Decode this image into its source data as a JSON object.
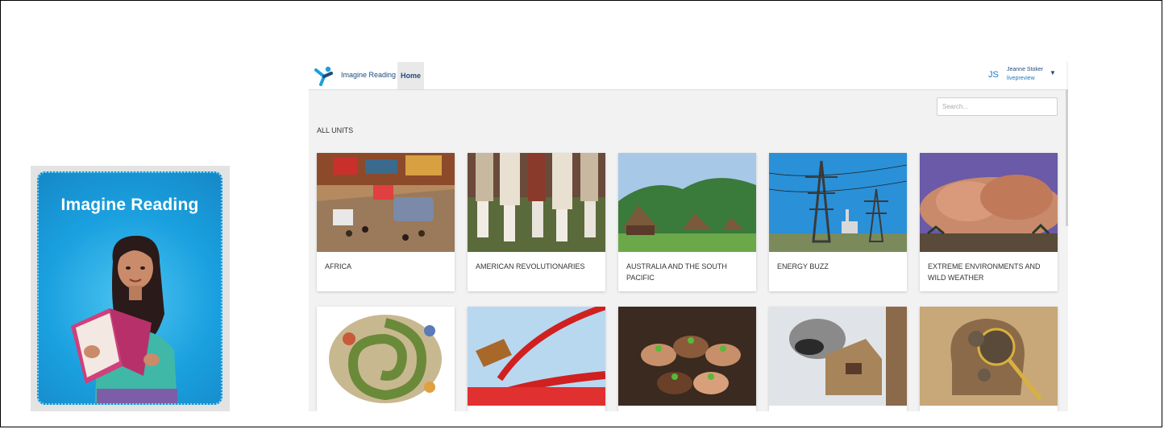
{
  "promo": {
    "title": "Imagine Reading"
  },
  "app": {
    "brand": "Imagine Reading",
    "nav": {
      "home": "Home"
    },
    "user": {
      "initials": "JS",
      "name": "Jeanne Stoker",
      "subtitle": "livepreview"
    },
    "search": {
      "placeholder": "Search..."
    },
    "section_title": "ALL UNITS",
    "units": [
      {
        "label": "AFRICA"
      },
      {
        "label": "AMERICAN REVOLUTIONARIES"
      },
      {
        "label": "AUSTRALIA AND THE SOUTH PACIFIC"
      },
      {
        "label": "ENERGY BUZZ"
      },
      {
        "label": "EXTREME ENVIRONMENTS AND WILD WEATHER"
      },
      {
        "label": ""
      },
      {
        "label": ""
      },
      {
        "label": ""
      },
      {
        "label": ""
      },
      {
        "label": ""
      }
    ]
  },
  "colors": {
    "brand_blue": "#1f4b7a",
    "accent_blue": "#1a7ac4",
    "promo_blue": "#1aa0df"
  }
}
